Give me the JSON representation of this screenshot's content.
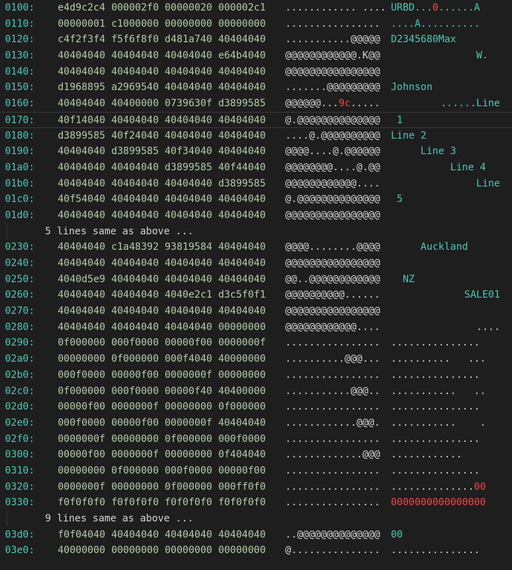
{
  "rows": [
    {
      "type": "line",
      "addr": "0100:",
      "hex": [
        "e4d9c2c4",
        "000002f0",
        "00000020",
        "000002c1"
      ],
      "ascii": "............ ....",
      "dec": [
        [
          "URBD...",
          "n"
        ],
        [
          "0",
          "e"
        ],
        [
          "......A",
          "n"
        ]
      ],
      "align": "left"
    },
    {
      "type": "line",
      "addr": "0110:",
      "hex": [
        "00000001",
        "c1000000",
        "00000000",
        "00000000"
      ],
      "ascii": "................",
      "dec": [
        [
          "....A..........",
          "n"
        ]
      ],
      "align": "left"
    },
    {
      "type": "line",
      "addr": "0120:",
      "hex": [
        "c4f2f3f4",
        "f5f6f8f0",
        "d481a740",
        "40404040"
      ],
      "ascii": "...........@@@@@",
      "dec": [
        [
          "D2345680Max",
          "n"
        ]
      ],
      "align": "left"
    },
    {
      "type": "line",
      "addr": "0130:",
      "hex": [
        "40404040",
        "40404040",
        "40404040",
        "e64b4040"
      ],
      "ascii": "@@@@@@@@@@@@.K@@",
      "dec": [
        [
          "W.  ",
          "n"
        ]
      ],
      "align": "right"
    },
    {
      "type": "line",
      "addr": "0140:",
      "hex": [
        "40404040",
        "40404040",
        "40404040",
        "40404040"
      ],
      "ascii": "@@@@@@@@@@@@@@@@",
      "dec": [],
      "align": "left"
    },
    {
      "type": "line",
      "addr": "0150:",
      "hex": [
        "d1968895",
        "a2969540",
        "40404040",
        "40404040"
      ],
      "ascii": ".......@@@@@@@@@",
      "dec": [
        [
          "Johnson",
          "n"
        ]
      ],
      "align": "left"
    },
    {
      "type": "line",
      "addr": "0160:",
      "hex": [
        "40404040",
        "40400000",
        "0739630f",
        "d3899585"
      ],
      "ascii": "@@@@@@...9c.....",
      "dec": [
        [
          "......Line",
          "n"
        ]
      ],
      "align": "right",
      "redAscii": true
    },
    {
      "type": "line",
      "addr": "0170:",
      "hex": [
        "40f14040",
        "40404040",
        "40404040",
        "40404040"
      ],
      "ascii": "@.@@@@@@@@@@@@@@",
      "dec": [
        [
          " 1",
          "n"
        ]
      ],
      "align": "left",
      "cursor": true
    },
    {
      "type": "line",
      "addr": "0180:",
      "hex": [
        "d3899585",
        "40f24040",
        "40404040",
        "40404040"
      ],
      "ascii": "....@.@@@@@@@@@@",
      "dec": [
        [
          "Line 2",
          "n"
        ]
      ],
      "align": "left"
    },
    {
      "type": "line",
      "addr": "0190:",
      "hex": [
        "40404040",
        "d3899585",
        "40f34040",
        "40404040"
      ],
      "ascii": "@@@@....@.@@@@@@",
      "dec": [
        [
          "     Line 3",
          "n"
        ]
      ],
      "align": "left"
    },
    {
      "type": "line",
      "addr": "01a0:",
      "hex": [
        "40404040",
        "40404040",
        "d3899585",
        "40f44040"
      ],
      "ascii": "@@@@@@@@....@.@@",
      "dec": [
        [
          "          Line 4",
          "n"
        ]
      ],
      "align": "left"
    },
    {
      "type": "line",
      "addr": "01b0:",
      "hex": [
        "40404040",
        "40404040",
        "40404040",
        "d3899585"
      ],
      "ascii": "@@@@@@@@@@@@....",
      "dec": [
        [
          "Line",
          "n"
        ]
      ],
      "align": "right"
    },
    {
      "type": "line",
      "addr": "01c0:",
      "hex": [
        "40f54040",
        "40404040",
        "40404040",
        "40404040"
      ],
      "ascii": "@.@@@@@@@@@@@@@@",
      "dec": [
        [
          " 5",
          "n"
        ]
      ],
      "align": "left"
    },
    {
      "type": "line",
      "addr": "01d0:",
      "hex": [
        "40404040",
        "40404040",
        "40404040",
        "40404040"
      ],
      "ascii": "@@@@@@@@@@@@@@@@",
      "dec": [],
      "align": "left"
    },
    {
      "type": "note",
      "text": "5 lines same as above ..."
    },
    {
      "type": "line",
      "addr": "0230:",
      "hex": [
        "40404040",
        "c1a48392",
        "93819584",
        "40404040"
      ],
      "ascii": "@@@@........@@@@",
      "dec": [
        [
          "     Auckland",
          "n"
        ]
      ],
      "align": "left"
    },
    {
      "type": "line",
      "addr": "0240:",
      "hex": [
        "40404040",
        "40404040",
        "40404040",
        "40404040"
      ],
      "ascii": "@@@@@@@@@@@@@@@@",
      "dec": [],
      "align": "left"
    },
    {
      "type": "line",
      "addr": "0250:",
      "hex": [
        "4040d5e9",
        "40404040",
        "40404040",
        "40404040"
      ],
      "ascii": "@@..@@@@@@@@@@@@",
      "dec": [
        [
          "  NZ",
          "n"
        ]
      ],
      "align": "left"
    },
    {
      "type": "line",
      "addr": "0260:",
      "hex": [
        "40404040",
        "40404040",
        "4040e2c1",
        "d3c5f0f1"
      ],
      "ascii": "@@@@@@@@@@......",
      "dec": [
        [
          "SALE01",
          "n"
        ]
      ],
      "align": "right"
    },
    {
      "type": "line",
      "addr": "0270:",
      "hex": [
        "40404040",
        "40404040",
        "40404040",
        "40404040"
      ],
      "ascii": "@@@@@@@@@@@@@@@@",
      "dec": [],
      "align": "left"
    },
    {
      "type": "line",
      "addr": "0280:",
      "hex": [
        "40404040",
        "40404040",
        "40404040",
        "00000000"
      ],
      "ascii": "@@@@@@@@@@@@....",
      "dec": [
        [
          "....",
          "w"
        ]
      ],
      "align": "right"
    },
    {
      "type": "line",
      "addr": "0290:",
      "hex": [
        "0f000000",
        "000f0000",
        "00000f00",
        "0000000f"
      ],
      "ascii": "................",
      "dec": [
        [
          "...............",
          "w"
        ]
      ],
      "align": "left"
    },
    {
      "type": "line",
      "addr": "02a0:",
      "hex": [
        "00000000",
        "0f000000",
        "000f4040",
        "40000000"
      ],
      "ascii": "..........@@@...",
      "dec": [
        [
          "..........   ...",
          "w"
        ]
      ],
      "align": "left"
    },
    {
      "type": "line",
      "addr": "02b0:",
      "hex": [
        "000f0000",
        "00000f00",
        "0000000f",
        "00000000"
      ],
      "ascii": "................",
      "dec": [
        [
          "...............",
          "w"
        ]
      ],
      "align": "left"
    },
    {
      "type": "line",
      "addr": "02c0:",
      "hex": [
        "0f000000",
        "000f0000",
        "00000f40",
        "40400000"
      ],
      "ascii": "...........@@@..",
      "dec": [
        [
          "...........   ..",
          "w"
        ]
      ],
      "align": "left"
    },
    {
      "type": "line",
      "addr": "02d0:",
      "hex": [
        "00000f00",
        "0000000f",
        "00000000",
        "0f000000"
      ],
      "ascii": "................",
      "dec": [
        [
          "...............",
          "w"
        ]
      ],
      "align": "left"
    },
    {
      "type": "line",
      "addr": "02e0:",
      "hex": [
        "000f0000",
        "00000f00",
        "0000000f",
        "40404040"
      ],
      "ascii": "............@@@.",
      "dec": [
        [
          "...........    .",
          "w"
        ]
      ],
      "align": "left"
    },
    {
      "type": "line",
      "addr": "02f0:",
      "hex": [
        "0000000f",
        "00000000",
        "0f000000",
        "000f0000"
      ],
      "ascii": "................",
      "dec": [
        [
          "...............",
          "w"
        ]
      ],
      "align": "left"
    },
    {
      "type": "line",
      "addr": "0300:",
      "hex": [
        "00000f00",
        "0000000f",
        "00000000",
        "0f404040"
      ],
      "ascii": ".............@@@",
      "dec": [
        [
          "............",
          "w"
        ]
      ],
      "align": "left"
    },
    {
      "type": "line",
      "addr": "0310:",
      "hex": [
        "00000000",
        "0f000000",
        "000f0000",
        "00000f00"
      ],
      "ascii": "................",
      "dec": [
        [
          "...............",
          "w"
        ]
      ],
      "align": "left"
    },
    {
      "type": "line",
      "addr": "0320:",
      "hex": [
        "0000000f",
        "00000000",
        "0f000000",
        "000ff0f0"
      ],
      "ascii": "................",
      "dec": [
        [
          "..............",
          "w"
        ],
        [
          "00",
          "e"
        ]
      ],
      "align": "left"
    },
    {
      "type": "line",
      "addr": "0330:",
      "hex": [
        "f0f0f0f0",
        "f0f0f0f0",
        "f0f0f0f0",
        "f0f0f0f0"
      ],
      "ascii": "................",
      "dec": [
        [
          "0000000000000000",
          "e"
        ]
      ],
      "align": "left"
    },
    {
      "type": "note",
      "text": "9 lines same as above ..."
    },
    {
      "type": "line",
      "addr": "03d0:",
      "hex": [
        "f0f04040",
        "40404040",
        "40404040",
        "40404040"
      ],
      "ascii": "..@@@@@@@@@@@@@@",
      "dec": [
        [
          "00",
          "n"
        ]
      ],
      "align": "left"
    },
    {
      "type": "line",
      "addr": "03e0:",
      "hex": [
        "40000000",
        "00000000",
        "00000000",
        "00000000"
      ],
      "ascii": "@...............",
      "dec": [
        [
          "...............",
          "w"
        ]
      ],
      "align": "left"
    }
  ],
  "colors": {
    "background": "#1e1e1e",
    "address": "#4ec9b0",
    "hex": "#b5cea8",
    "ascii": "#d4d4d4",
    "decoded": "#4ec9b0",
    "highlight": "#f44747"
  }
}
